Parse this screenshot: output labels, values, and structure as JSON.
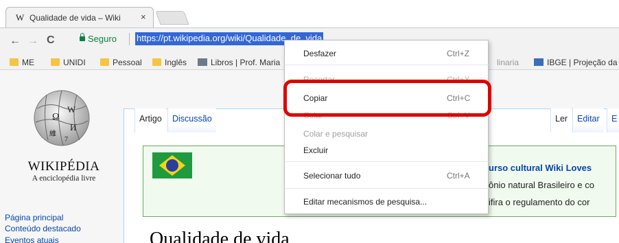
{
  "browser": {
    "tab_title": "Qualidade de vida – Wiki",
    "tab_favicon": "W",
    "tab_close": "×",
    "secure_label": "Seguro",
    "url": "https://pt.wikipedia.org/wiki/Qualidade_de_vida",
    "nav": {
      "back": "←",
      "forward": "→",
      "reload": "C"
    }
  },
  "bookmarks": [
    {
      "label": "ME",
      "icon": "folder-icon"
    },
    {
      "label": "UNIDI",
      "icon": "folder-icon"
    },
    {
      "label": "Pessoal",
      "icon": "folder-icon"
    },
    {
      "label": "Inglês",
      "icon": "folder-icon"
    },
    {
      "label": "Libros | Prof. Maria",
      "icon": "site-icon"
    },
    {
      "label": "linaria",
      "icon": "none"
    },
    {
      "label": "IBGE | Projeção da p",
      "icon": "ibge-icon"
    }
  ],
  "wiki": {
    "wordmark": "WIKIPÉDIA",
    "tagline": "A enciclopédia livre",
    "sidebar": [
      "Página principal",
      "Conteúdo destacado",
      "Eventos atuais"
    ],
    "tabs_left": [
      "Artigo",
      "Discussão"
    ],
    "tabs_right": [
      "Ler",
      "Editar",
      "E"
    ],
    "banner": {
      "line1": "urso cultural Wiki Loves",
      "line2": "ônio natural Brasileiro e co",
      "line3": "ifira o regulamento do cor"
    },
    "page_title": "Qualidade de vida"
  },
  "context_menu": {
    "items": [
      {
        "label": "Desfazer",
        "shortcut": "Ctrl+Z",
        "state": "enabled"
      },
      {
        "label": "Recortar",
        "shortcut": "Ctrl+X",
        "state": "struck"
      },
      {
        "label": "Copiar",
        "shortcut": "Ctrl+C",
        "state": "enabled"
      },
      {
        "label": "Colar",
        "shortcut": "Ctrl+V",
        "state": "struck"
      },
      {
        "label": "Colar e pesquisar",
        "shortcut": "",
        "state": "disabled"
      },
      {
        "label": "Excluir",
        "shortcut": "",
        "state": "enabled"
      },
      {
        "label": "Selecionar tudo",
        "shortcut": "Ctrl+A",
        "state": "enabled"
      },
      {
        "label": "Editar mecanismos de pesquisa...",
        "shortcut": "",
        "state": "enabled"
      }
    ]
  },
  "colors": {
    "url_selection": "#3367d6",
    "secure_green": "#0b8043",
    "highlight_red": "#e00000",
    "wiki_link": "#0645ad"
  }
}
